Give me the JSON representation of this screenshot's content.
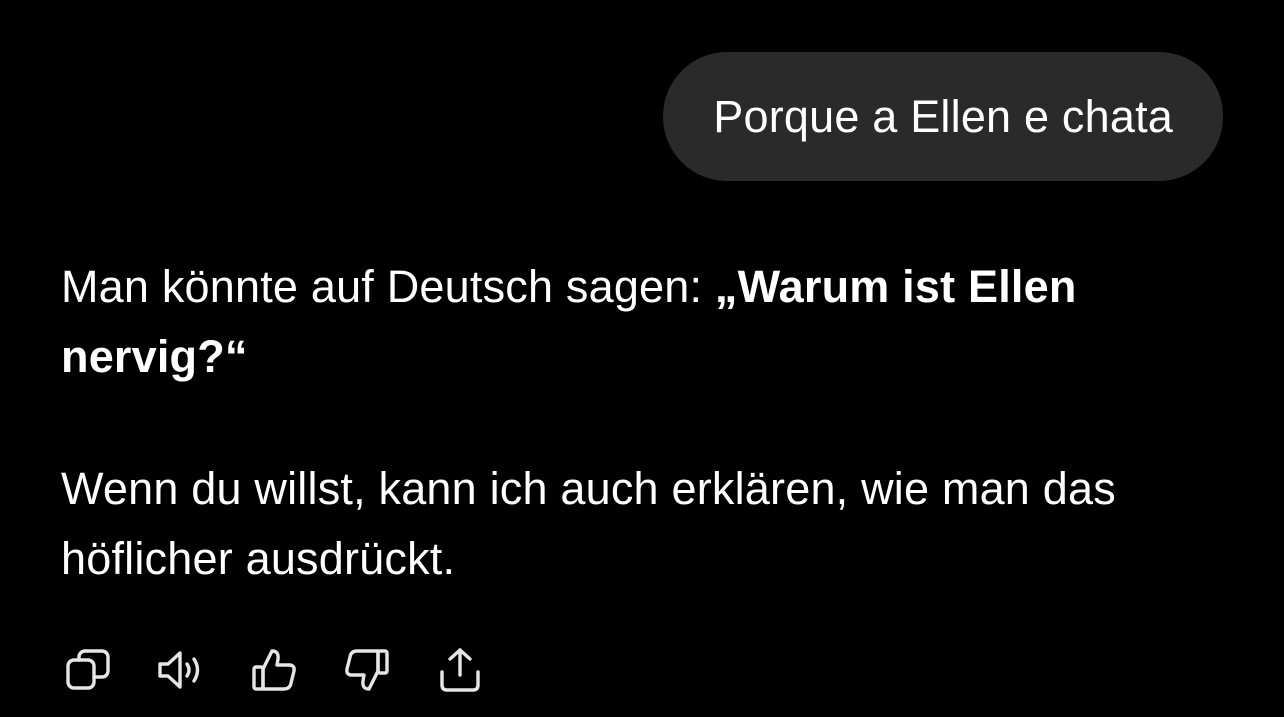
{
  "conversation": {
    "user_message": "Porque a Ellen e chata",
    "assistant": {
      "paragraph1_prefix": "Man könnte auf Deutsch sagen: ",
      "paragraph1_bold": "„Warum ist Ellen nervig?“",
      "paragraph2": "Wenn du willst, kann ich auch erklären, wie man das höflicher ausdrückt."
    }
  },
  "actions": [
    {
      "icon": "copy-icon"
    },
    {
      "icon": "speaker-icon"
    },
    {
      "icon": "thumbs-up-icon"
    },
    {
      "icon": "thumbs-down-icon"
    },
    {
      "icon": "share-icon"
    }
  ],
  "colors": {
    "background": "#000000",
    "user_bubble": "#2a2a2a",
    "text": "#ffffff",
    "icon": "#e6e6e6"
  }
}
